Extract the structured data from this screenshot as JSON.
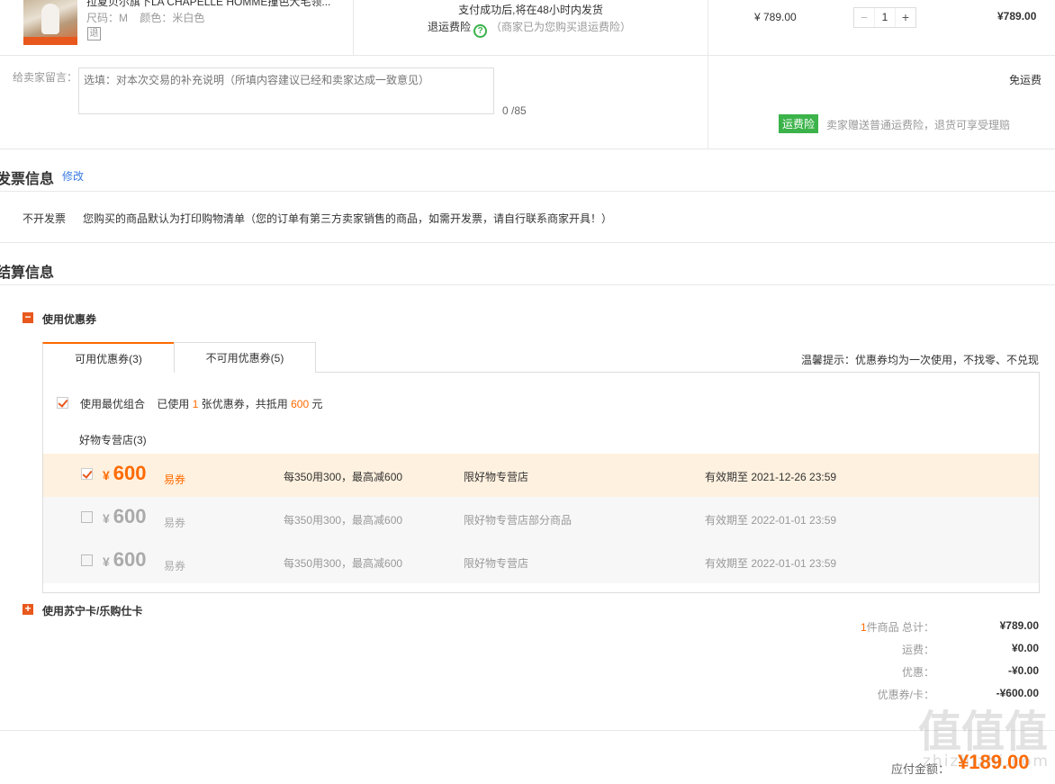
{
  "product": {
    "title": "拉夏贝尔旗下LA CHAPELLE HOMME撞色大毛领...",
    "size_label": "尺码：M",
    "color_label": "颜色：米白色",
    "return_icon": "退",
    "ship_note": "支付成功后,将在48小时内发货",
    "insurance_label": "退运费险",
    "insurance_note": "（商家已为您购买退运费险）",
    "unit_price": "¥ 789.00",
    "qty_minus": "−",
    "qty": "1",
    "qty_plus": "+",
    "subtotal": "¥789.00"
  },
  "message": {
    "label": "给卖家留言：",
    "placeholder": "选填：对本次交易的补充说明（所填内容建议已经和卖家达成一致意见）",
    "count": "0 /85",
    "shipping": "免运费",
    "insurance_badge": "运费险",
    "insurance_desc": "卖家赠送普通运费险，退货可享受理赔"
  },
  "invoice": {
    "title": "发票信息",
    "edit": "修改",
    "type": "不开发票",
    "desc": "您购买的商品默认为打印购物清单（您的订单有第三方卖家销售的商品，如需开发票，请自行联系商家开具！）"
  },
  "settlement": {
    "title": "结算信息",
    "coupon_section": "使用优惠券",
    "coupon_toggle": "−",
    "tabs": [
      {
        "label": "可用优惠券(3)"
      },
      {
        "label": "不可用优惠券(5)"
      }
    ],
    "tip": "温馨提示：优惠券均为一次使用，不找零、不兑现",
    "best_combo": {
      "label": "使用最优组合",
      "used_prefix": "已使用",
      "used_count": "1",
      "used_mid": "张优惠券，共抵用",
      "used_amount": "600",
      "used_suffix": "元"
    },
    "store": "好物专营店(3)",
    "coupons": [
      {
        "currency": "¥",
        "amount": "600",
        "kind": "易券",
        "rule": "每350用300，最高减600",
        "scope": "限好物专营店",
        "expire": "有效期至 2021-12-26 23:59"
      },
      {
        "currency": "¥",
        "amount": "600",
        "kind": "易券",
        "rule": "每350用300，最高减600",
        "scope": "限好物专营店部分商品",
        "expire": "有效期至 2022-01-01 23:59"
      },
      {
        "currency": "¥",
        "amount": "600",
        "kind": "易券",
        "rule": "每350用300，最高减600",
        "scope": "限好物专营店",
        "expire": "有效期至 2022-01-01 23:59"
      }
    ],
    "card_section": "使用苏宁卡/乐购仕卡",
    "card_toggle": "+"
  },
  "summary": {
    "items_count": "1",
    "items_label": "件商品 总计：",
    "total": "¥789.00",
    "freight_label": "运费：",
    "freight": "¥0.00",
    "discount_label": "优惠：",
    "discount": "-¥0.00",
    "coupon_label": "优惠券/卡：",
    "coupon": "-¥600.00",
    "pay_label": "应付金额：",
    "pay": "¥189.00"
  },
  "watermark": {
    "glyphs": "值值值",
    "url": "zhizhizhi.com"
  },
  "colors": {
    "accent": "#ff6a00",
    "toggle": "#e8581c",
    "green": "#3bb34a",
    "link": "#3a7be0",
    "active_row": "#fff1df"
  }
}
